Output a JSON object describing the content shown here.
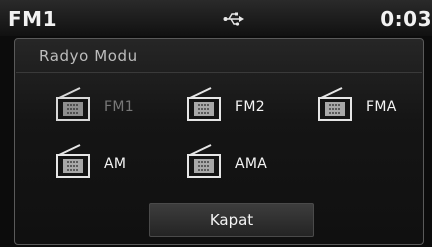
{
  "status_bar": {
    "title": "FM1",
    "usb_icon": "usb-icon",
    "clock": "0:03"
  },
  "popup": {
    "title": "Radyo Modu",
    "bands": [
      {
        "label": "FM1",
        "icon": "radio-icon",
        "selected": true
      },
      {
        "label": "FM2",
        "icon": "radio-icon",
        "selected": false
      },
      {
        "label": "FMA",
        "icon": "radio-icon",
        "selected": false
      },
      {
        "label": "AM",
        "icon": "radio-icon",
        "selected": false
      },
      {
        "label": "AMA",
        "icon": "radio-icon",
        "selected": false
      }
    ],
    "close_label": "Kapat"
  },
  "colors": {
    "background": "#0c0c0c",
    "text": "#f4f4f4",
    "selected_text": "#777777"
  }
}
